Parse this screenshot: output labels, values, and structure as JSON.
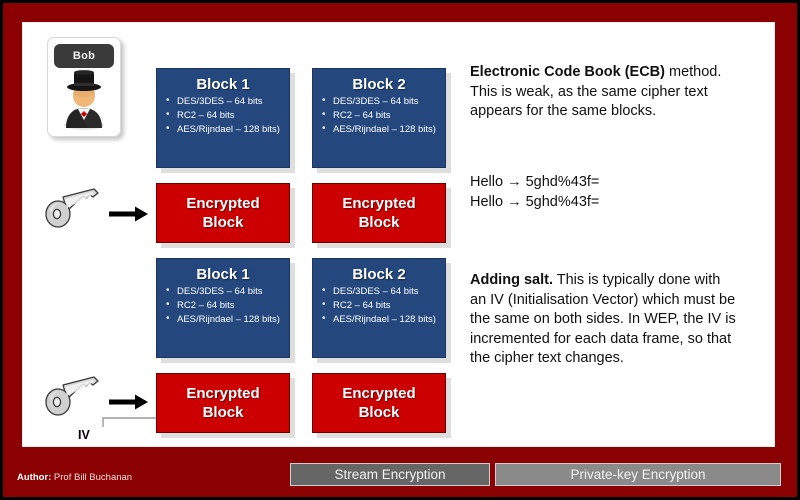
{
  "slide": {
    "frame_color": "#8b0000",
    "canvas_color": "#ffffff"
  },
  "actor": {
    "name": "Bob",
    "icon": "person-tophat-icon"
  },
  "keys": [
    {
      "icon": "key-icon",
      "arrow": "arrow-right-icon"
    },
    {
      "icon": "key-icon",
      "arrow": "arrow-right-icon"
    }
  ],
  "iv_callout": {
    "label": "IV",
    "icon": "callout-arrow-icon"
  },
  "blocks": {
    "color": "#24487e",
    "items": [
      {
        "title": "Block 1",
        "bullets": [
          "DES/3DES – 64 bits",
          "RC2 – 64 bits",
          "AES/Rijndael – 128 bits)"
        ]
      },
      {
        "title": "Block 2",
        "bullets": [
          "DES/3DES – 64 bits",
          "RC2 – 64 bits",
          "AES/Rijndael – 128 bits)"
        ]
      },
      {
        "title": "Block 1",
        "bullets": [
          "DES/3DES – 64 bits",
          "RC2 – 64 bits",
          "AES/Rijndael – 128 bits)"
        ]
      },
      {
        "title": "Block 2",
        "bullets": [
          "DES/3DES – 64 bits",
          "RC2 – 64 bits",
          "AES/Rijndael – 128 bits)"
        ]
      }
    ]
  },
  "encrypted_blocks": {
    "color": "#cc0000",
    "line1": "Encrypted",
    "line2": "Block",
    "count": 4
  },
  "texts": {
    "ecb": {
      "lead": "Electronic Code Book (ECB)",
      "body": " method. This is weak, as the same cipher text appears for the same blocks."
    },
    "example_lines": [
      "Hello → 5ghd%43f=",
      "Hello →  5ghd%43f="
    ],
    "salt": {
      "lead": "Adding salt.",
      "body": " This is typically done with an IV (Initialisation Vector) which must be the same on both sides. In WEP, the IV is incremented for each data frame, so that the cipher text changes."
    }
  },
  "footer": {
    "author_label": "Author:",
    "author_name": " Prof Bill Buchanan",
    "buttons": [
      {
        "label": "Stream Encryption",
        "color": "#666666"
      },
      {
        "label": "Private-key Encryption",
        "color": "#8a8a8a"
      }
    ]
  }
}
